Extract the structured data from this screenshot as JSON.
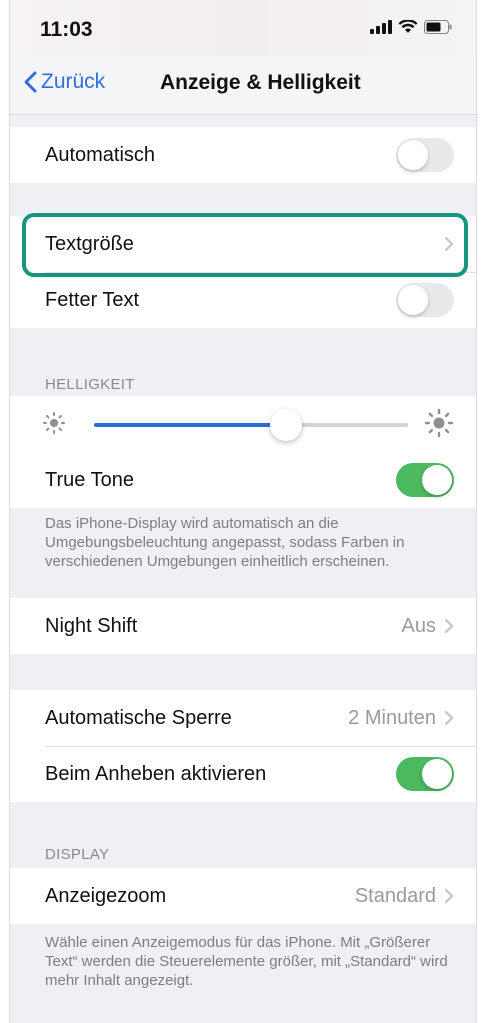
{
  "status_bar": {
    "time": "11:03"
  },
  "nav": {
    "back_label": "Zurück",
    "title": "Anzeige & Helligkeit"
  },
  "appearance": {
    "automatic_label": "Automatisch",
    "automatic_on": false
  },
  "text": {
    "text_size_label": "Textgröße",
    "bold_text_label": "Fetter Text",
    "bold_text_on": false
  },
  "brightness": {
    "section_header": "HELLIGKEIT",
    "level": 0.61,
    "true_tone_label": "True Tone",
    "true_tone_on": true,
    "footer": "Das iPhone-Display wird automatisch an die Umgebungsbeleuchtung angepasst, sodass Farben in verschiedenen Umgebungen einheitlich erscheinen."
  },
  "night_shift": {
    "label": "Night Shift",
    "value": "Aus"
  },
  "lock": {
    "auto_lock_label": "Automatische Sperre",
    "auto_lock_value": "2 Minuten",
    "raise_to_wake_label": "Beim Anheben aktivieren",
    "raise_to_wake_on": true
  },
  "display": {
    "section_header": "DISPLAY",
    "zoom_label": "Anzeigezoom",
    "zoom_value": "Standard",
    "footer": "Wähle einen Anzeigemodus für das iPhone. Mit „Größerer Text“ werden die Steuerelemente größer, mit „Standard“ wird mehr Inhalt angezeigt."
  },
  "colors": {
    "accent": "#2f6fe0",
    "toggle_on": "#4cb860",
    "highlight": "#179580"
  }
}
